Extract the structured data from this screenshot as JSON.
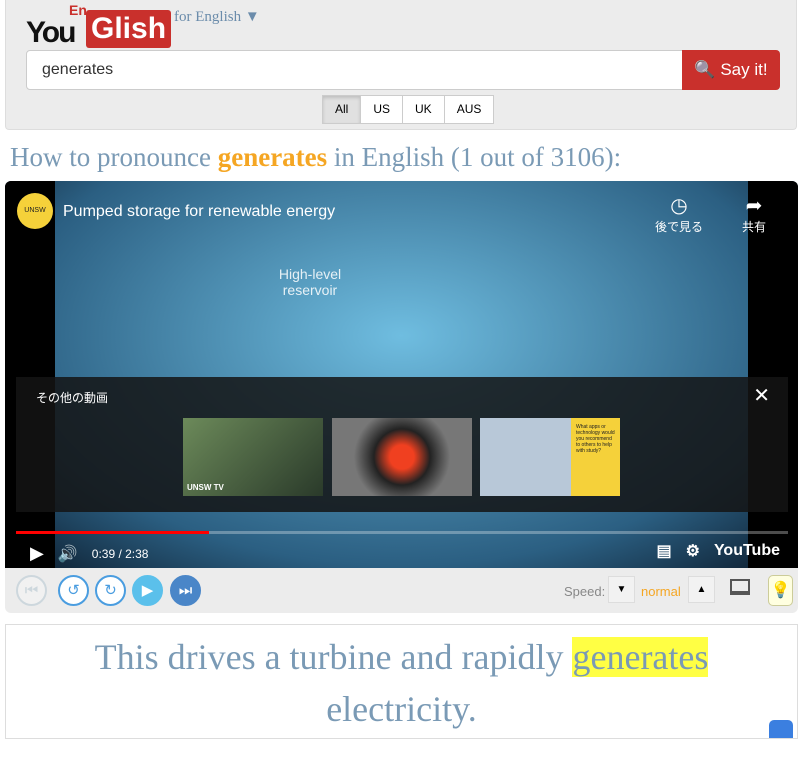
{
  "header": {
    "logo_you": "You",
    "logo_en": "En",
    "logo_glish": "Glish",
    "lang_selector": "for English ▼",
    "search_value": "generates",
    "say_it": "Say it!",
    "accents": [
      "All",
      "US",
      "UK",
      "AUS"
    ],
    "accent_selected": "All"
  },
  "heading": {
    "prefix": "How to pronounce ",
    "word": "generates",
    "suffix": " in English (1 out of 3106):"
  },
  "video": {
    "title": "Pumped storage for renewable energy",
    "channel_logo": "UNSW",
    "watch_later": "後で見る",
    "share": "共有",
    "overlay_text": "High-level reservoir",
    "more_videos": "その他の動画",
    "time": "0:39 / 2:38",
    "progress_percent": 25,
    "brand": "YouTube",
    "thumb1_label": "UNSW TV",
    "thumb3_text": "What apps or technology would you recommend to others to help with study?"
  },
  "controls": {
    "speed_label": "Speed:",
    "speed_value": "normal"
  },
  "caption": {
    "before": "This drives a turbine and rapidly ",
    "word": "generates",
    "after": " electricity."
  },
  "colors": {
    "accent_red": "#c9302c",
    "highlight_orange": "#f5a623",
    "text_blue": "#7a9ab5",
    "player_blue": "#4a9de0"
  }
}
